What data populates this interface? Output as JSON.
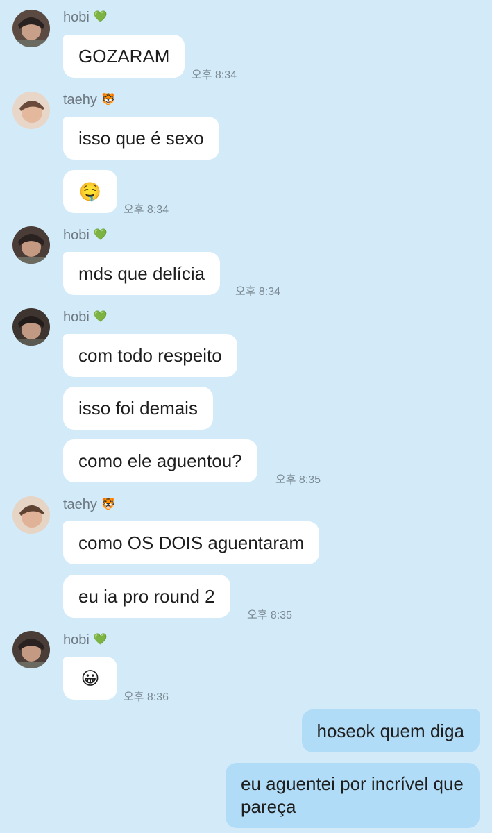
{
  "senders": {
    "hobi": {
      "name": "hobi",
      "badge": "💚"
    },
    "taehy": {
      "name": "taehy",
      "badge": "🐯"
    }
  },
  "time_prefix": "오후",
  "groups": [
    {
      "sender": "hobi",
      "messages": [
        "GOZARAM"
      ],
      "time": "오후 8:34"
    },
    {
      "sender": "taehy",
      "messages": [
        "isso que é sexo",
        "🤤"
      ],
      "time": "오후 8:34"
    },
    {
      "sender": "hobi",
      "messages": [
        "mds que delícia"
      ],
      "time": "오후 8:34"
    },
    {
      "sender": "hobi",
      "messages": [
        "com todo respeito",
        "isso foi demais",
        "como ele aguentou?"
      ],
      "time": "오후 8:35"
    },
    {
      "sender": "taehy",
      "messages": [
        "como OS DOIS aguentaram",
        "eu ia pro round 2"
      ],
      "time": "오후 8:35"
    },
    {
      "sender": "hobi",
      "messages": [
        "😀"
      ],
      "time": "오후 8:36"
    }
  ],
  "outgoing": [
    "hoseok quem diga",
    "eu aguentei por incrível que pareça"
  ],
  "colors": {
    "background": "#d3ebf9",
    "incoming_bubble": "#ffffff",
    "outgoing_bubble": "#b1dcf7"
  }
}
